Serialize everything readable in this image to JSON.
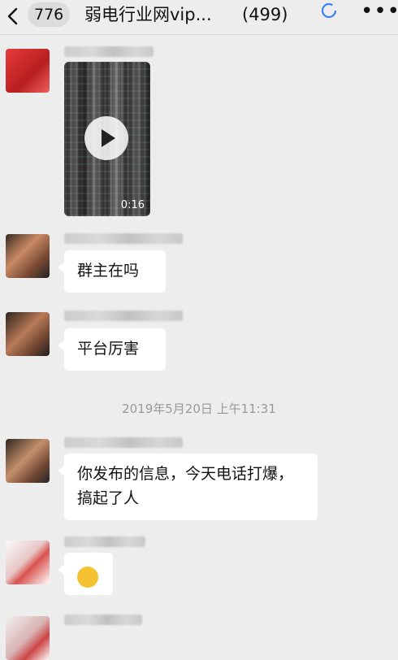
{
  "header": {
    "unread_count": "776",
    "title": "弱电行业网vip...",
    "member_count": "(499)"
  },
  "messages": {
    "video_duration": "0:16",
    "text1": "群主在吗",
    "text2": "平台厉害",
    "timestamp": "2019年5月20日 上午11:31",
    "text3": "你发布的信息，今天电话打爆，搞起了人"
  },
  "colors": {
    "background": "#ededed",
    "bubble": "#ffffff",
    "accent_icon": "#3b82f6"
  }
}
